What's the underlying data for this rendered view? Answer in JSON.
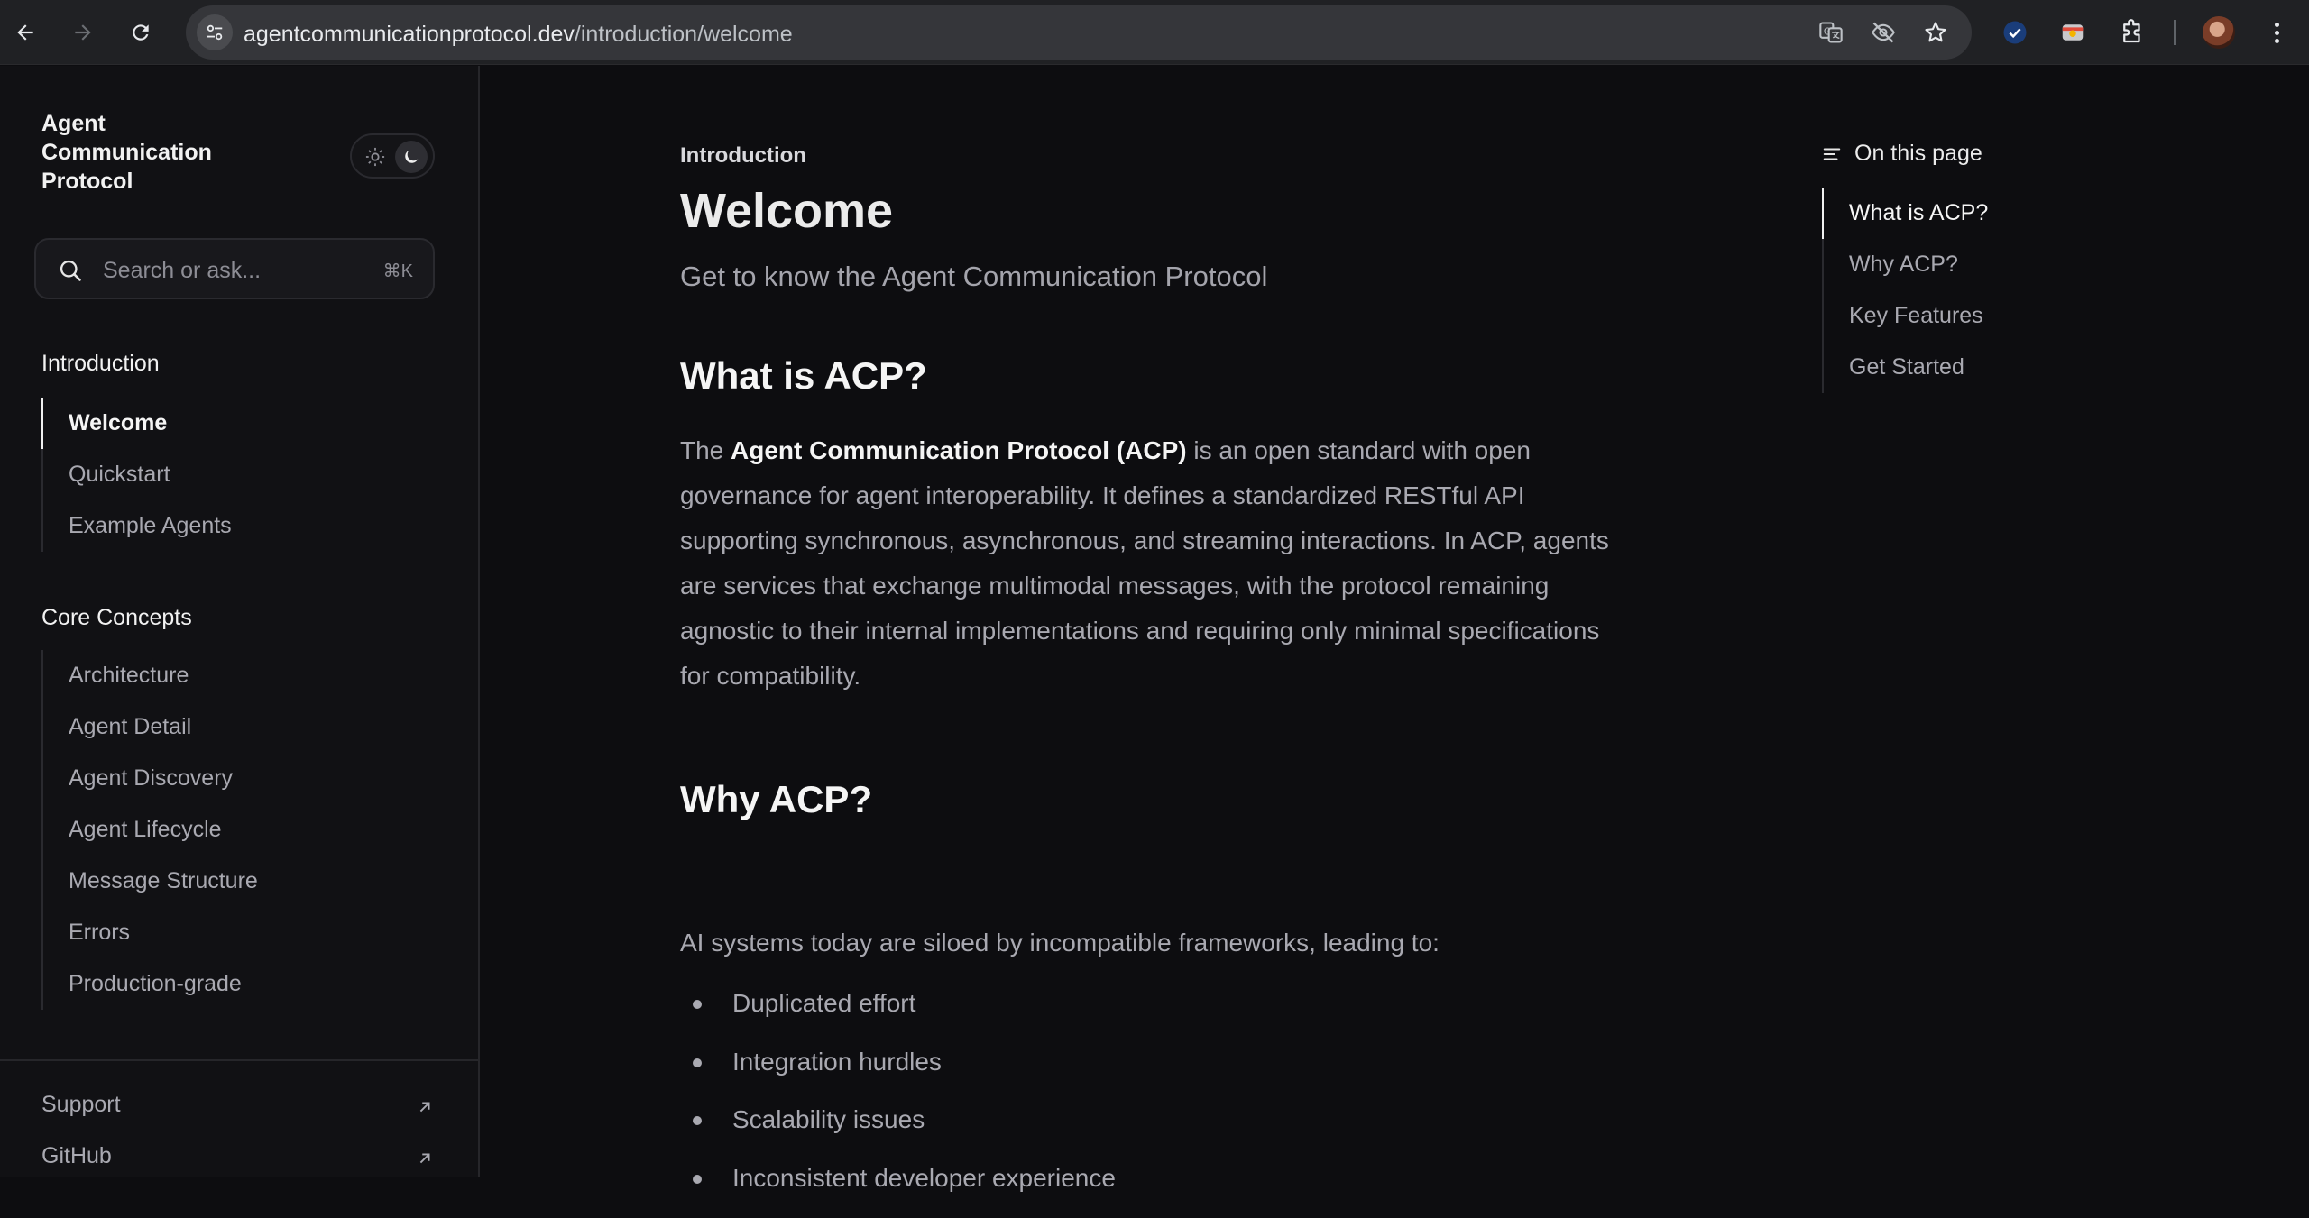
{
  "browser": {
    "url_host": "agentcommunicationprotocol.dev",
    "url_path": "/introduction/welcome",
    "icons": [
      "back-icon",
      "forward-icon",
      "reload-icon",
      "site-info-icon",
      "translate-icon",
      "eye-off-icon",
      "star-icon",
      "checkmark-extension-icon",
      "chrome-extension-icon",
      "puzzle-icon",
      "profile-avatar",
      "more-menu-icon"
    ]
  },
  "sidebar": {
    "brand": "Agent Communication Protocol",
    "search": {
      "placeholder": "Search or ask...",
      "shortcut": "⌘K"
    },
    "sections": [
      {
        "title": "Introduction",
        "items": [
          {
            "label": "Welcome",
            "active": true
          },
          {
            "label": "Quickstart"
          },
          {
            "label": "Example Agents"
          }
        ]
      },
      {
        "title": "Core Concepts",
        "items": [
          {
            "label": "Architecture"
          },
          {
            "label": "Agent Detail"
          },
          {
            "label": "Agent Discovery"
          },
          {
            "label": "Agent Lifecycle"
          },
          {
            "label": "Message Structure"
          },
          {
            "label": "Errors"
          },
          {
            "label": "Production-grade"
          }
        ]
      }
    ],
    "footer_links": [
      {
        "label": "Support"
      },
      {
        "label": "GitHub"
      }
    ]
  },
  "content": {
    "eyebrow": "Introduction",
    "title": "Welcome",
    "subtitle": "Get to know the Agent Communication Protocol",
    "section1": {
      "heading": "What is ACP?",
      "para_prefix": "The ",
      "para_bold": "Agent Communication Protocol (ACP)",
      "para_rest": " is an open standard with open governance for agent interoperability. It defines a standardized RESTful API supporting synchronous, asynchronous, and streaming interactions. In ACP, agents are services that exchange multimodal messages, with the protocol remaining agnostic to their internal implementations and requiring only minimal specifications for compatibility."
    },
    "section2": {
      "heading": "Why ACP?",
      "intro": "AI systems today are siloed by incompatible frameworks, leading to:",
      "bullets": [
        "Duplicated effort",
        "Integration hurdles",
        "Scalability issues",
        "Inconsistent developer experience"
      ]
    }
  },
  "toc": {
    "header": "On this page",
    "items": [
      {
        "label": "What is ACP?",
        "active": true
      },
      {
        "label": "Why ACP?"
      },
      {
        "label": "Key Features"
      },
      {
        "label": "Get Started"
      }
    ]
  },
  "colors": {
    "background": "#0d0d10",
    "sidebar": "#111114",
    "text_primary": "#f5f5f5",
    "text_muted": "#a9a9b1"
  }
}
